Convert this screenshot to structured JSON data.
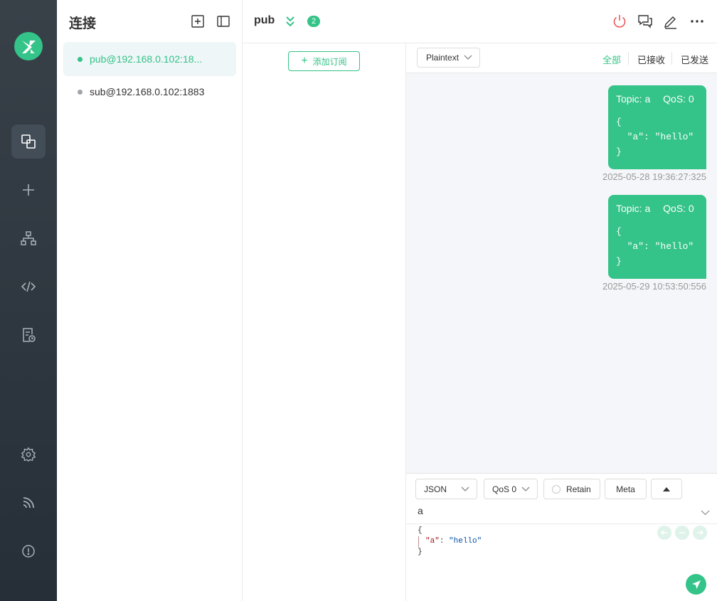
{
  "sidebar": {
    "title": "连接",
    "connections": [
      {
        "name": "pub@192.168.0.102:18...",
        "active": true,
        "status_color": "#34c388"
      },
      {
        "name": "sub@192.168.0.102:1883",
        "active": false,
        "status_color": "#a0a4ab"
      }
    ]
  },
  "header": {
    "title": "pub",
    "subscription_count": "2"
  },
  "subscriptions": {
    "add_label": "添加订阅"
  },
  "messages": {
    "format": "Plaintext",
    "filters": [
      "全部",
      "已接收",
      "已发送"
    ],
    "items": [
      {
        "topic_label": "Topic: a",
        "qos_label": "QoS: 0",
        "payload": "{\n  \"a\": \"hello\"\n}",
        "time": "2025-05-28 19:36:27:325"
      },
      {
        "topic_label": "Topic: a",
        "qos_label": "QoS: 0",
        "payload": "{\n  \"a\": \"hello\"\n}",
        "time": "2025-05-29 10:53:50:556"
      }
    ]
  },
  "composer": {
    "format": "JSON",
    "qos": "QoS 0",
    "retain_label": "Retain",
    "meta_label": "Meta",
    "topic": "a",
    "payload": {
      "open": "{",
      "key": "\"a\"",
      "colon": ": ",
      "value": "\"hello\"",
      "close": "}"
    }
  },
  "colors": {
    "accent": "#34c388",
    "rail": "#2f3740",
    "disconnect": "#e95b5b"
  },
  "icons": [
    "logo-icon",
    "connections-icon",
    "new-connection-icon",
    "topology-icon",
    "script-icon",
    "log-icon",
    "settings-icon",
    "feed-icon",
    "about-icon",
    "new-tab-icon",
    "toggle-panel-icon",
    "expand-subs-icon",
    "disconnect-icon",
    "messages-icon",
    "edit-icon",
    "more-icon",
    "send-icon"
  ]
}
